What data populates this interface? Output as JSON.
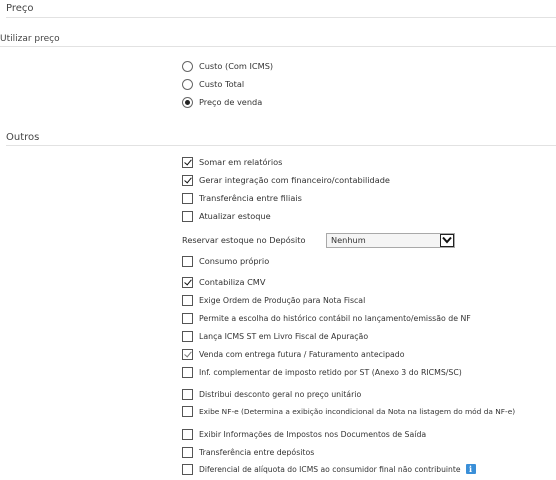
{
  "sections": {
    "preco_title": "Preço",
    "utilizar_preco_title": "Utilizar preço",
    "outros_title": "Outros"
  },
  "price_options": [
    {
      "label": "Custo (Com ICMS)",
      "selected": false
    },
    {
      "label": "Custo Total",
      "selected": false
    },
    {
      "label": "Preço de venda",
      "selected": true
    }
  ],
  "outros": {
    "somar_relatorios": {
      "label": "Somar em relatórios",
      "checked": true
    },
    "gerar_integracao": {
      "label": "Gerar integração com financeiro/contabilidade",
      "checked": true
    },
    "transferencia_filiais": {
      "label": "Transferência entre filiais",
      "checked": false
    },
    "atualizar_estoque": {
      "label": "Atualizar estoque",
      "checked": false
    },
    "reservar_estoque": {
      "label": "Reservar estoque no Depósito",
      "value": "Nenhum"
    },
    "consumo_proprio": {
      "label": "Consumo próprio",
      "checked": false
    },
    "contabiliza_cmv": {
      "label": "Contabiliza CMV",
      "checked": true
    },
    "exige_ordem": {
      "label": "Exige Ordem de Produção para Nota Fiscal",
      "checked": false
    },
    "permite_historico": {
      "label": "Permite a escolha do histórico contábil no lançamento/emissão de NF",
      "checked": false
    },
    "lanca_icms": {
      "label": "Lança ICMS ST em Livro Fiscal de Apuração",
      "checked": false
    },
    "venda_entrega": {
      "label": "Venda com entrega futura / Faturamento antecipado",
      "checked": true
    },
    "inf_complementar": {
      "label": "Inf. complementar de imposto retido por ST (Anexo 3 do RICMS/SC)",
      "checked": false
    },
    "distribui_desconto": {
      "label": "Distribui desconto geral no preço unitário",
      "checked": false
    },
    "exibe_nfe": {
      "label": "Exibe NF-e (Determina a exibição incondicional da Nota na listagem do mód da NF-e)",
      "checked": false
    },
    "exibir_informacoes": {
      "label": "Exibir Informações de Impostos nos Documentos de Saída",
      "checked": false
    },
    "transferencia_depositos": {
      "label": "Transferência entre depósitos",
      "checked": false
    },
    "diferencial_aliquota": {
      "label": "Diferencial de alíquota do ICMS ao consumidor final não contribuinte",
      "checked": false
    }
  },
  "icons": {
    "info": "info-icon",
    "dropdown": "chevron-down-icon"
  },
  "info_glyph": "i"
}
